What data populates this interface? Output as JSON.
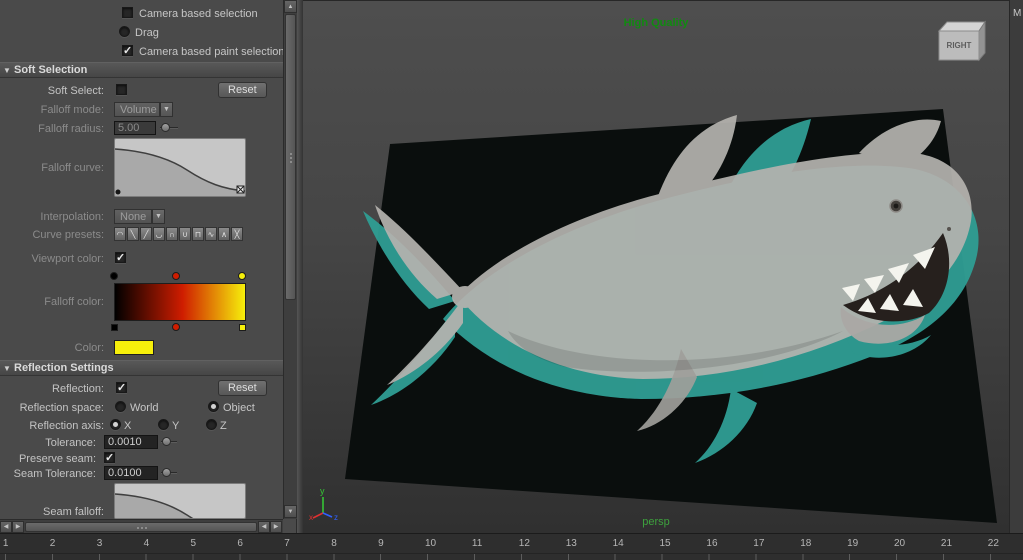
{
  "window": {
    "right_strip_label": "M"
  },
  "panel": {
    "top_options": {
      "camera_based_selection": {
        "label": "Camera based selection",
        "checked": false
      },
      "drag": {
        "label": "Drag",
        "selected": false
      },
      "camera_based_paint_selection": {
        "label": "Camera based paint selection",
        "checked": true
      }
    },
    "soft_selection": {
      "header": "Soft Selection",
      "soft_select": {
        "label": "Soft Select:",
        "checked": false
      },
      "reset_label": "Reset",
      "falloff_mode": {
        "label": "Falloff mode:",
        "value": "Volume"
      },
      "falloff_radius": {
        "label": "Falloff radius:",
        "value": "5.00"
      },
      "falloff_curve_label": "Falloff curve:",
      "interpolation": {
        "label": "Interpolation:",
        "value": "None"
      },
      "curve_presets_label": "Curve presets:",
      "curve_presets": [
        {
          "name": "curve-preset-smooth",
          "glyph": "◠"
        },
        {
          "name": "curve-preset-linear-down",
          "glyph": "╲"
        },
        {
          "name": "curve-preset-linear-up",
          "glyph": "╱"
        },
        {
          "name": "curve-preset-concave",
          "glyph": "◡"
        },
        {
          "name": "curve-preset-dome",
          "glyph": "∩"
        },
        {
          "name": "curve-preset-valley",
          "glyph": "∪"
        },
        {
          "name": "curve-preset-plateau",
          "glyph": "⊓"
        },
        {
          "name": "curve-preset-sine",
          "glyph": "∿"
        },
        {
          "name": "curve-preset-spike",
          "glyph": "∧"
        },
        {
          "name": "curve-preset-cross",
          "glyph": "╳"
        }
      ],
      "viewport_color": {
        "label": "Viewport color:",
        "checked": true
      },
      "falloff_color_label": "Falloff color:",
      "ramp_colors": [
        "#000000",
        "#cf1d00",
        "#f6ef0b"
      ],
      "color": {
        "label": "Color:",
        "value": "#f6ef0b"
      }
    },
    "reflection": {
      "header": "Reflection Settings",
      "reflection": {
        "label": "Reflection:",
        "checked": true
      },
      "reset_label": "Reset",
      "space": {
        "label": "Reflection space:",
        "options": [
          {
            "label": "World",
            "selected": false
          },
          {
            "label": "Object",
            "selected": true
          }
        ]
      },
      "axis": {
        "label": "Reflection axis:",
        "options": [
          {
            "label": "X",
            "selected": true
          },
          {
            "label": "Y",
            "selected": false
          },
          {
            "label": "Z",
            "selected": false
          }
        ]
      },
      "tolerance": {
        "label": "Tolerance:",
        "value": "0.0010"
      },
      "preserve_seam": {
        "label": "Preserve seam:",
        "checked": true
      },
      "seam_tolerance": {
        "label": "Seam Tolerance:",
        "value": "0.0100"
      },
      "seam_falloff_label": "Seam falloff:"
    }
  },
  "viewport": {
    "quality_label": "High Quality",
    "camera_label": "persp",
    "view_cube": {
      "label": "RIGHT"
    },
    "axis_gizmo": {
      "x": "x",
      "y": "y",
      "z": "z"
    },
    "colors": {
      "hud_green": "#118a11",
      "persp_green": "#3da13d",
      "sketch_teal": "#2f9e94",
      "model_gray": "#b5b3af",
      "image_plane_black": "#0a0e0d"
    }
  },
  "timeline": {
    "frames": [
      "1",
      "2",
      "3",
      "4",
      "5",
      "6",
      "7",
      "8",
      "9",
      "10",
      "11",
      "12",
      "13",
      "14",
      "15",
      "16",
      "17",
      "18",
      "19",
      "20",
      "21",
      "22"
    ]
  }
}
